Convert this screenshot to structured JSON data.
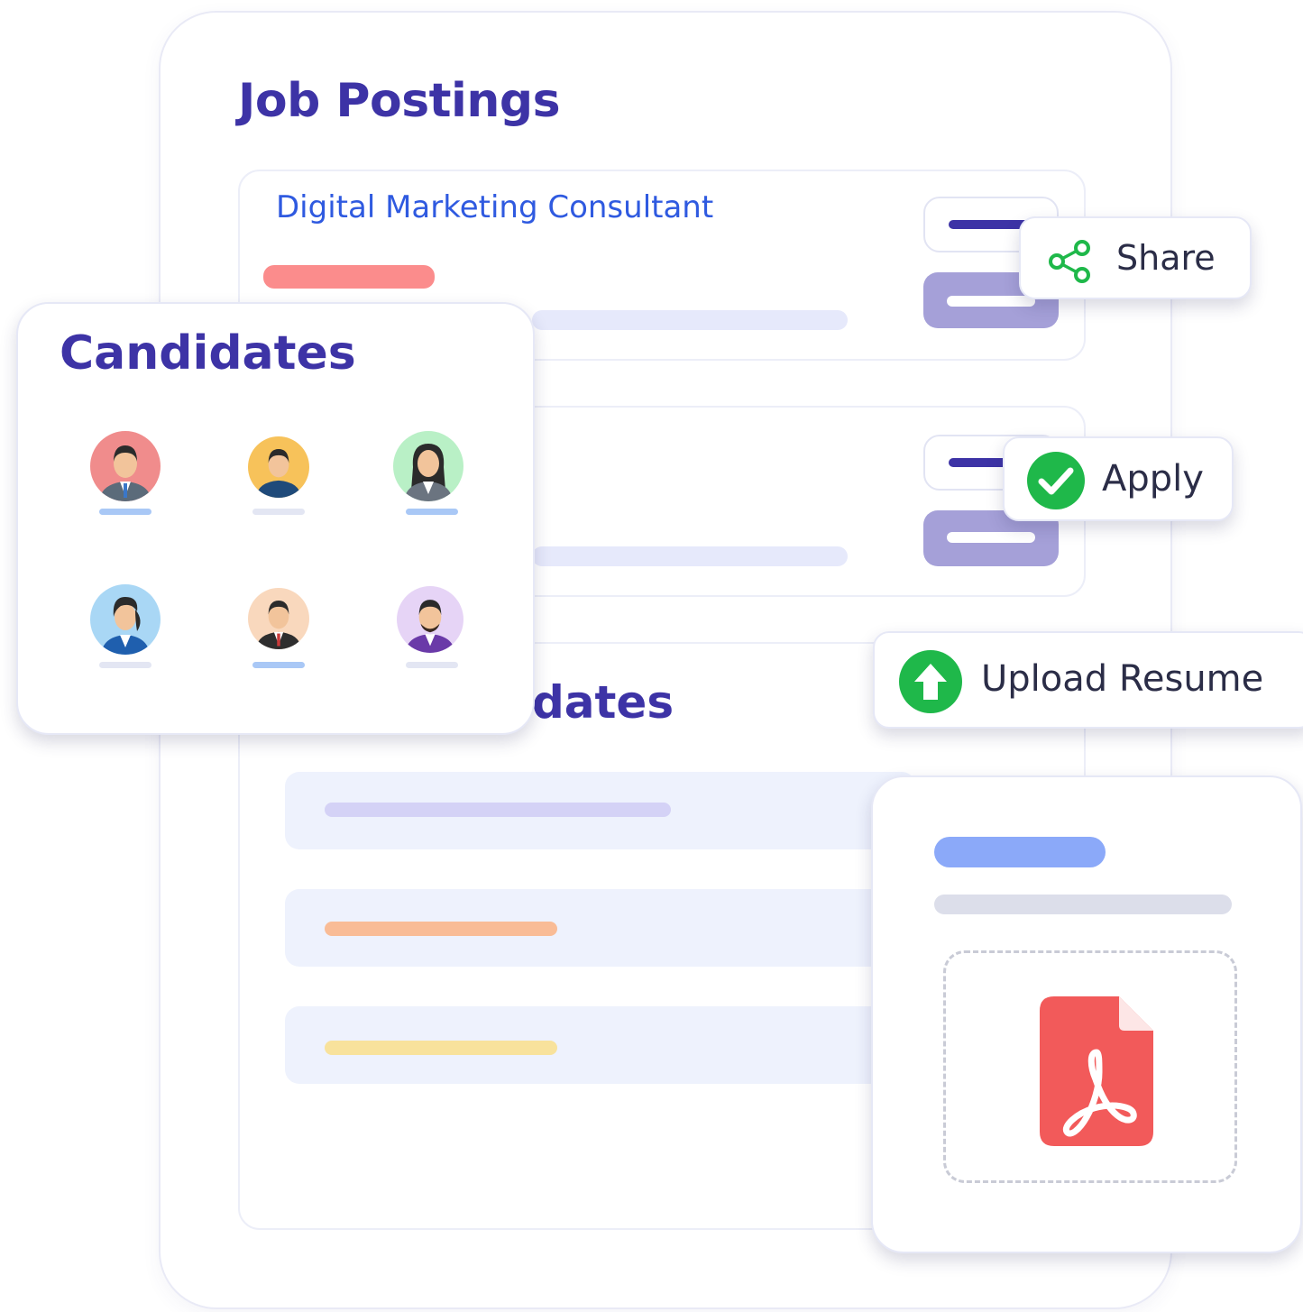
{
  "job_postings": {
    "title": "Job Postings",
    "postings": [
      {
        "title": "Digital Marketing Consultant"
      }
    ],
    "candidates_heading_partial": "dates"
  },
  "actions": {
    "share_label": "Share",
    "apply_label": "Apply",
    "upload_label": "Upload Resume"
  },
  "candidates_panel": {
    "title": "Candidates",
    "avatars": [
      {
        "icon": "male-avatar-icon",
        "bg": "#f08c8c"
      },
      {
        "icon": "male-avatar-icon",
        "bg": "#f7c25a"
      },
      {
        "icon": "female-avatar-icon",
        "bg": "#b9f0c6"
      },
      {
        "icon": "female-avatar-icon",
        "bg": "#a9d7f5"
      },
      {
        "icon": "male-avatar-icon",
        "bg": "#f9d8bd"
      },
      {
        "icon": "male-avatar-icon",
        "bg": "#e6d4f6"
      }
    ]
  },
  "resume_card": {
    "file_icon": "pdf-file-icon"
  },
  "colors": {
    "primary": "#3d33a6",
    "link": "#2f5ae0",
    "accent_green": "#1fb84a",
    "pdf_red": "#f25a5a"
  }
}
